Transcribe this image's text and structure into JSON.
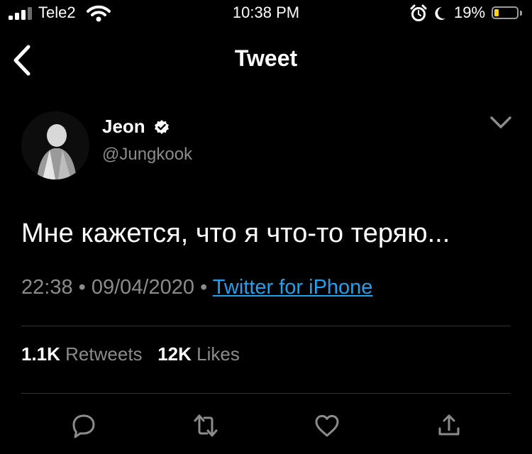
{
  "status_bar": {
    "carrier": "Tele2",
    "time": "10:38 PM",
    "battery_percent": "19%",
    "battery_level": 0.19,
    "battery_color": "#ffd60a",
    "icons": [
      "signal-icon",
      "wifi-icon",
      "alarm-icon",
      "moon-icon",
      "battery-icon"
    ]
  },
  "nav": {
    "title": "Tweet",
    "back_icon": "chevron-left-icon"
  },
  "tweet": {
    "author_name": "Jeon",
    "author_handle": "@Jungkook",
    "text": "Мне кажется, что я что-то теряю...",
    "time": "22:38",
    "date": "09/04/2020",
    "source": "Twitter for iPhone",
    "retweets_count": "1.1K",
    "retweets_label": "Retweets",
    "likes_count": "12K",
    "likes_label": "Likes"
  },
  "actions": [
    "reply-icon",
    "retweet-icon",
    "like-icon",
    "share-icon"
  ],
  "colors": {
    "background": "#000000",
    "text": "#ffffff",
    "secondary_text": "#8b8b8b",
    "link": "#1da1f2",
    "divider": "#333333"
  }
}
